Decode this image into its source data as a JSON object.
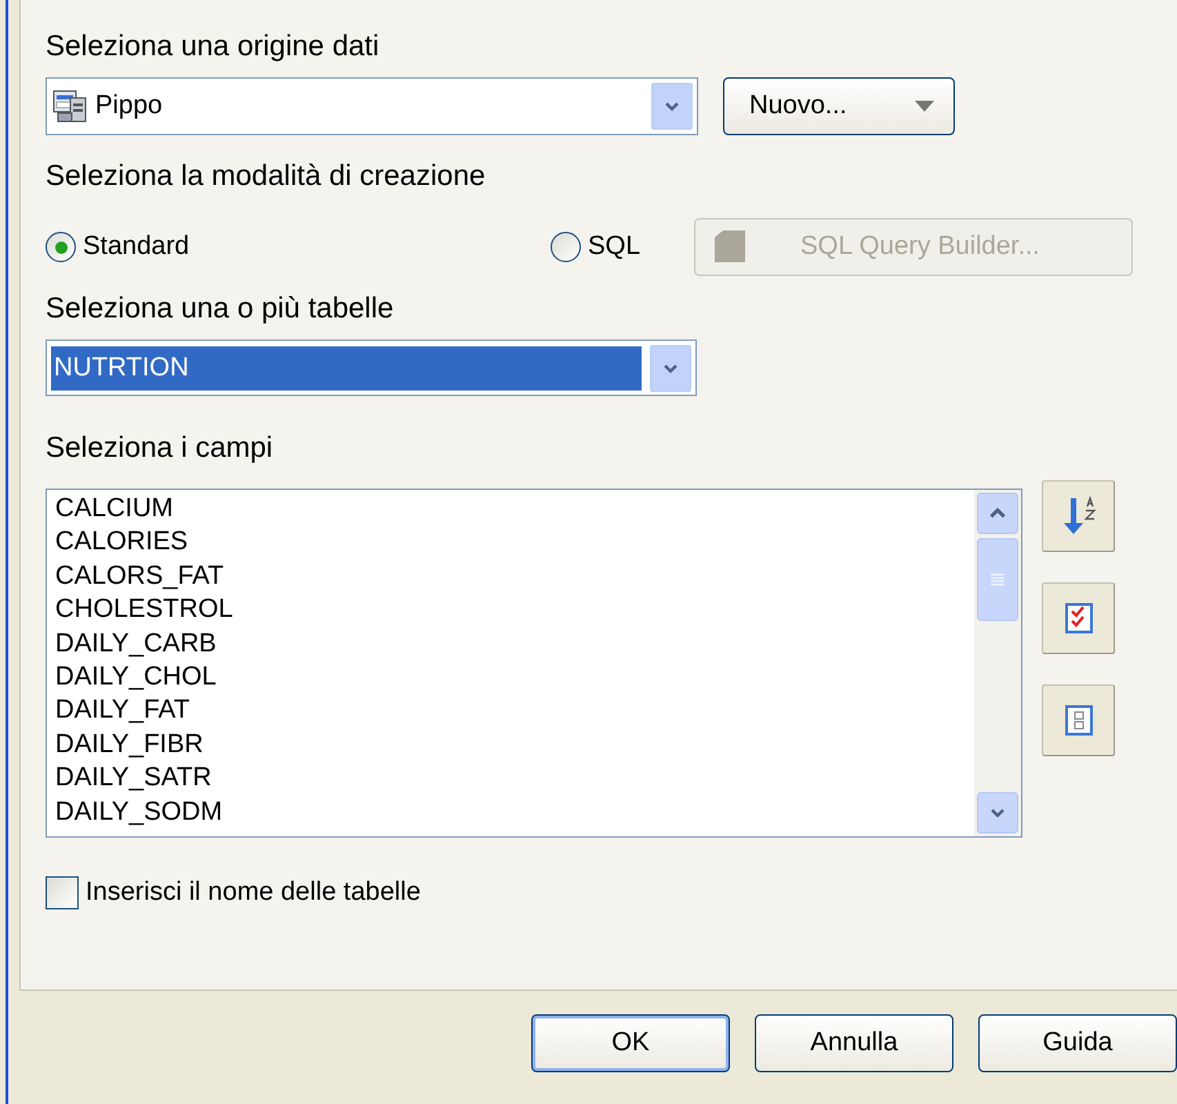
{
  "source_label": "Seleziona una origine dati",
  "source_combo": {
    "value": "Pippo"
  },
  "new_button": {
    "label": "Nuovo..."
  },
  "mode_label": "Seleziona la modalità di creazione",
  "modes": [
    {
      "label": "Standard",
      "selected": true
    },
    {
      "label": "SQL",
      "selected": false
    }
  ],
  "query_builder_button": {
    "label": "SQL Query Builder...",
    "disabled": true
  },
  "table_label": "Seleziona una o più tabelle",
  "table_combo": {
    "value": "NUTRTION",
    "selected": true
  },
  "fields_label": "Seleziona i campi",
  "fields": [
    "CALCIUM",
    "CALORIES",
    "CALORS_FAT",
    "CHOLESTROL",
    "DAILY_CARB",
    "DAILY_CHOL",
    "DAILY_FAT",
    "DAILY_FIBR",
    "DAILY_SATR",
    "DAILY_SODM"
  ],
  "insert_table_names": {
    "label": "Inserisci il nome delle tabelle",
    "checked": false
  },
  "buttons": [
    {
      "label": "OK",
      "default": true
    },
    {
      "label": "Annulla",
      "default": false
    },
    {
      "label": "Guida",
      "default": false
    }
  ]
}
